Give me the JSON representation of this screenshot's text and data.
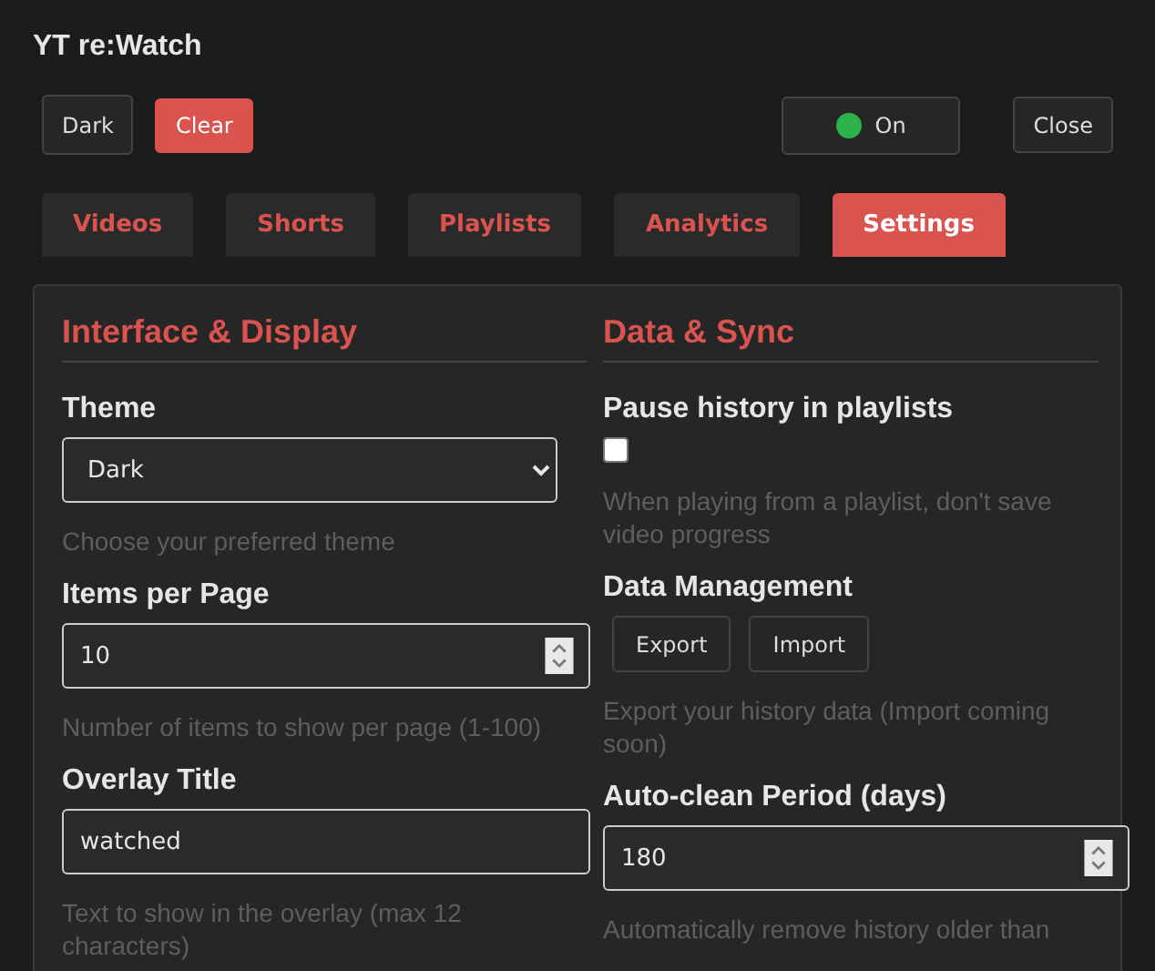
{
  "app_title": "YT re:Watch",
  "toolbar": {
    "buttons": [
      {
        "label": "Dark",
        "kind": "plain"
      },
      {
        "label": "Clear",
        "kind": "danger"
      }
    ],
    "toggle": {
      "label": "On",
      "on": true
    },
    "close": "Close"
  },
  "tabs": [
    {
      "label": "Videos",
      "selected": false
    },
    {
      "label": "Shorts",
      "selected": false
    },
    {
      "label": "Playlists",
      "selected": false
    },
    {
      "label": "Analytics",
      "selected": false
    },
    {
      "label": "Settings",
      "selected": true
    }
  ],
  "sections": [
    {
      "heading": "Interface & Display",
      "settings": [
        {
          "kind": "select",
          "label": "Theme",
          "value": "Dark",
          "hint": "Choose your preferred theme"
        },
        {
          "kind": "number",
          "label": "Items per Page",
          "value": "10",
          "hint": "Number of items to show per page (1-100)"
        },
        {
          "kind": "text",
          "label": "Overlay Title",
          "value": "watched",
          "hint": "Text to show in the overlay (max 12 characters)"
        }
      ]
    },
    {
      "heading": "Data & Sync",
      "settings": [
        {
          "kind": "checkbox",
          "label": "Pause history in playlists",
          "checked": false,
          "hint": "When playing from a playlist, don't save video progress"
        },
        {
          "kind": "buttons",
          "label": "Data Management",
          "buttons": [
            "Export",
            "Import"
          ],
          "hint": "Export your history data (Import coming soon)"
        },
        {
          "kind": "number",
          "label": "Auto-clean Period (days)",
          "value": "180",
          "hint": "Automatically remove history older than"
        }
      ]
    }
  ]
}
